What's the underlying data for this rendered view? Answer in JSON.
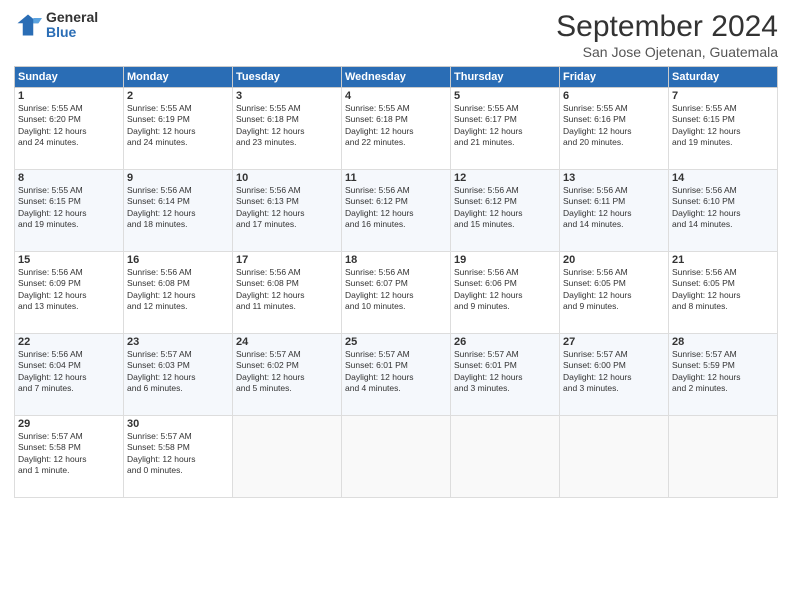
{
  "logo": {
    "general": "General",
    "blue": "Blue"
  },
  "header": {
    "month": "September 2024",
    "location": "San Jose Ojetenan, Guatemala"
  },
  "weekdays": [
    "Sunday",
    "Monday",
    "Tuesday",
    "Wednesday",
    "Thursday",
    "Friday",
    "Saturday"
  ],
  "weeks": [
    [
      {
        "day": "1",
        "sunrise": "5:55 AM",
        "sunset": "6:20 PM",
        "daylight": "12 hours and 24 minutes."
      },
      {
        "day": "2",
        "sunrise": "5:55 AM",
        "sunset": "6:19 PM",
        "daylight": "12 hours and 24 minutes."
      },
      {
        "day": "3",
        "sunrise": "5:55 AM",
        "sunset": "6:18 PM",
        "daylight": "12 hours and 23 minutes."
      },
      {
        "day": "4",
        "sunrise": "5:55 AM",
        "sunset": "6:18 PM",
        "daylight": "12 hours and 22 minutes."
      },
      {
        "day": "5",
        "sunrise": "5:55 AM",
        "sunset": "6:17 PM",
        "daylight": "12 hours and 21 minutes."
      },
      {
        "day": "6",
        "sunrise": "5:55 AM",
        "sunset": "6:16 PM",
        "daylight": "12 hours and 20 minutes."
      },
      {
        "day": "7",
        "sunrise": "5:55 AM",
        "sunset": "6:15 PM",
        "daylight": "12 hours and 19 minutes."
      }
    ],
    [
      {
        "day": "8",
        "sunrise": "5:55 AM",
        "sunset": "6:15 PM",
        "daylight": "12 hours and 19 minutes."
      },
      {
        "day": "9",
        "sunrise": "5:56 AM",
        "sunset": "6:14 PM",
        "daylight": "12 hours and 18 minutes."
      },
      {
        "day": "10",
        "sunrise": "5:56 AM",
        "sunset": "6:13 PM",
        "daylight": "12 hours and 17 minutes."
      },
      {
        "day": "11",
        "sunrise": "5:56 AM",
        "sunset": "6:12 PM",
        "daylight": "12 hours and 16 minutes."
      },
      {
        "day": "12",
        "sunrise": "5:56 AM",
        "sunset": "6:12 PM",
        "daylight": "12 hours and 15 minutes."
      },
      {
        "day": "13",
        "sunrise": "5:56 AM",
        "sunset": "6:11 PM",
        "daylight": "12 hours and 14 minutes."
      },
      {
        "day": "14",
        "sunrise": "5:56 AM",
        "sunset": "6:10 PM",
        "daylight": "12 hours and 14 minutes."
      }
    ],
    [
      {
        "day": "15",
        "sunrise": "5:56 AM",
        "sunset": "6:09 PM",
        "daylight": "12 hours and 13 minutes."
      },
      {
        "day": "16",
        "sunrise": "5:56 AM",
        "sunset": "6:08 PM",
        "daylight": "12 hours and 12 minutes."
      },
      {
        "day": "17",
        "sunrise": "5:56 AM",
        "sunset": "6:08 PM",
        "daylight": "12 hours and 11 minutes."
      },
      {
        "day": "18",
        "sunrise": "5:56 AM",
        "sunset": "6:07 PM",
        "daylight": "12 hours and 10 minutes."
      },
      {
        "day": "19",
        "sunrise": "5:56 AM",
        "sunset": "6:06 PM",
        "daylight": "12 hours and 9 minutes."
      },
      {
        "day": "20",
        "sunrise": "5:56 AM",
        "sunset": "6:05 PM",
        "daylight": "12 hours and 9 minutes."
      },
      {
        "day": "21",
        "sunrise": "5:56 AM",
        "sunset": "6:05 PM",
        "daylight": "12 hours and 8 minutes."
      }
    ],
    [
      {
        "day": "22",
        "sunrise": "5:56 AM",
        "sunset": "6:04 PM",
        "daylight": "12 hours and 7 minutes."
      },
      {
        "day": "23",
        "sunrise": "5:57 AM",
        "sunset": "6:03 PM",
        "daylight": "12 hours and 6 minutes."
      },
      {
        "day": "24",
        "sunrise": "5:57 AM",
        "sunset": "6:02 PM",
        "daylight": "12 hours and 5 minutes."
      },
      {
        "day": "25",
        "sunrise": "5:57 AM",
        "sunset": "6:01 PM",
        "daylight": "12 hours and 4 minutes."
      },
      {
        "day": "26",
        "sunrise": "5:57 AM",
        "sunset": "6:01 PM",
        "daylight": "12 hours and 3 minutes."
      },
      {
        "day": "27",
        "sunrise": "5:57 AM",
        "sunset": "6:00 PM",
        "daylight": "12 hours and 3 minutes."
      },
      {
        "day": "28",
        "sunrise": "5:57 AM",
        "sunset": "5:59 PM",
        "daylight": "12 hours and 2 minutes."
      }
    ],
    [
      {
        "day": "29",
        "sunrise": "5:57 AM",
        "sunset": "5:58 PM",
        "daylight": "12 hours and 1 minute."
      },
      {
        "day": "30",
        "sunrise": "5:57 AM",
        "sunset": "5:58 PM",
        "daylight": "12 hours and 0 minutes."
      },
      null,
      null,
      null,
      null,
      null
    ]
  ]
}
